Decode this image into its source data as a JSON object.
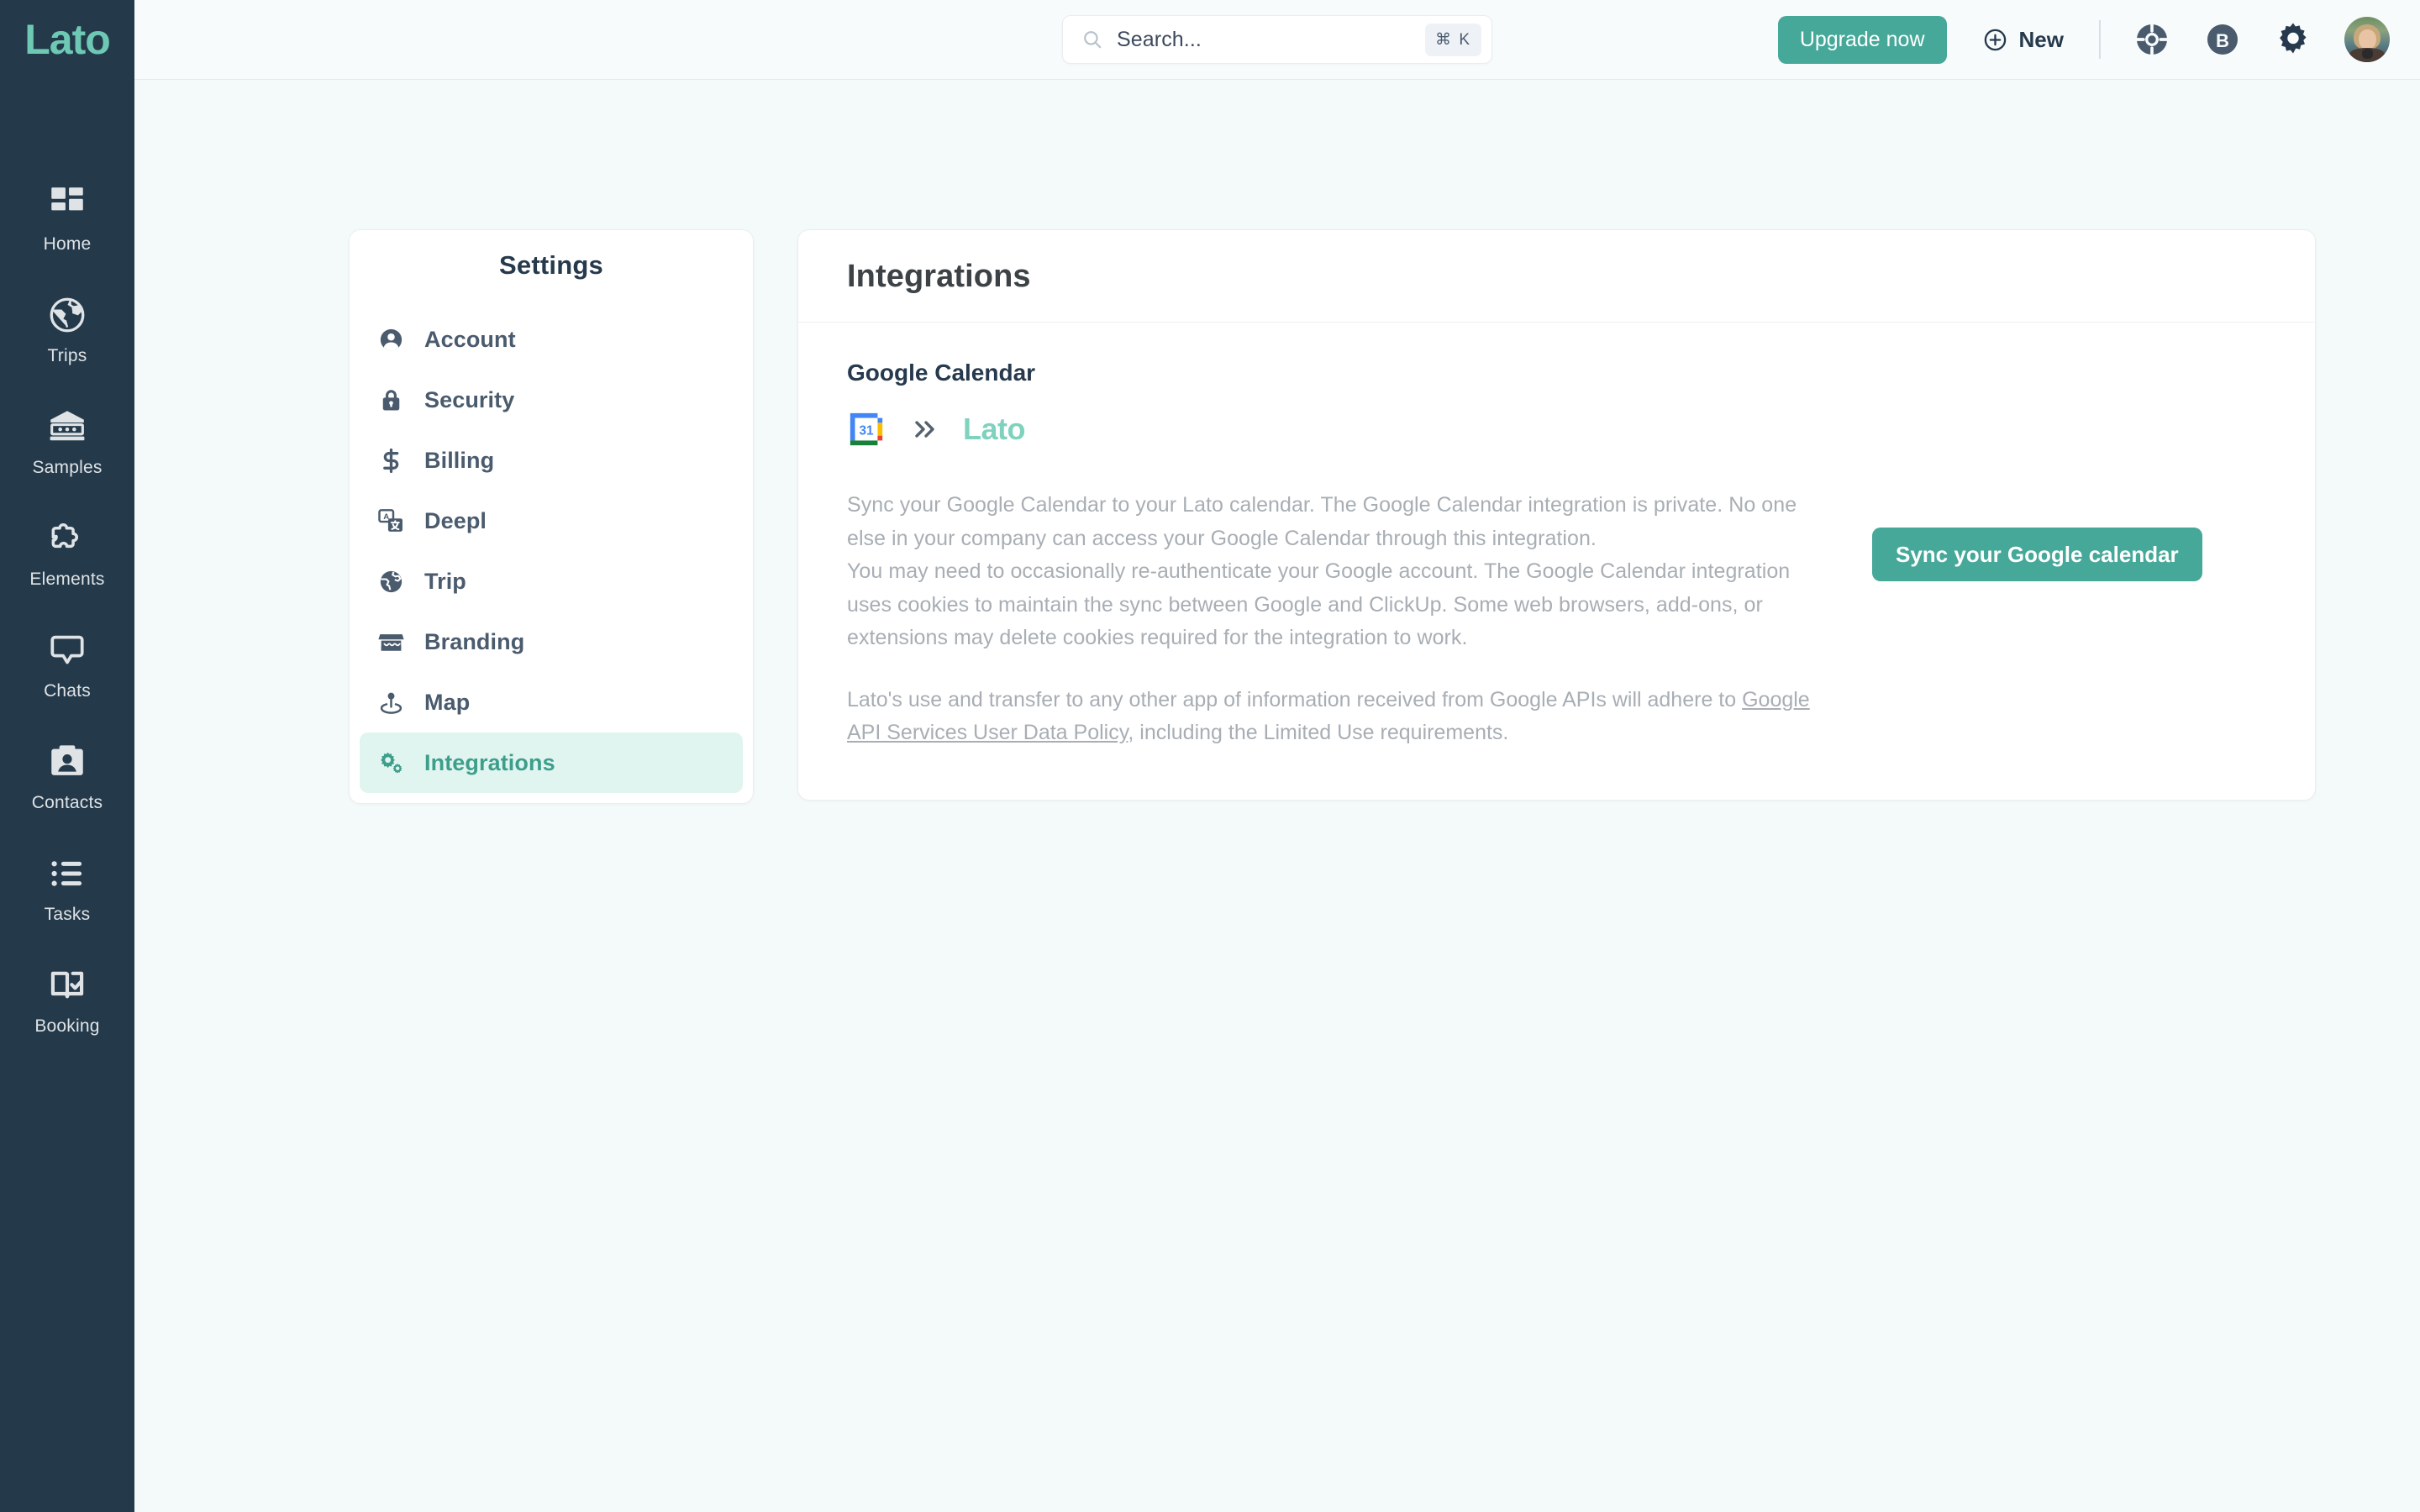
{
  "brand": {
    "name": "Lato"
  },
  "rail": {
    "items": [
      {
        "icon": "dashboard-icon",
        "label": "Home"
      },
      {
        "icon": "globe-icon",
        "label": "Trips"
      },
      {
        "icon": "bank-icon",
        "label": "Samples"
      },
      {
        "icon": "puzzle-icon",
        "label": "Elements"
      },
      {
        "icon": "chat-icon",
        "label": "Chats"
      },
      {
        "icon": "contact-card-icon",
        "label": "Contacts"
      },
      {
        "icon": "list-icon",
        "label": "Tasks"
      },
      {
        "icon": "book-check-icon",
        "label": "Booking"
      }
    ]
  },
  "topbar": {
    "search": {
      "placeholder": "Search...",
      "value": "",
      "shortcut": "⌘ K",
      "icon": "search-icon"
    },
    "upgrade_label": "Upgrade now",
    "new_label": "New",
    "new_icon": "plus-circle-icon",
    "icons": [
      {
        "name": "lifebuoy-icon"
      },
      {
        "name": "brand-b-icon"
      },
      {
        "name": "gear-icon"
      }
    ],
    "avatar_alt": "User avatar"
  },
  "settings_panel": {
    "title": "Settings",
    "items": [
      {
        "icon": "person-circle-icon",
        "label": "Account",
        "active": false
      },
      {
        "icon": "lock-icon",
        "label": "Security",
        "active": false
      },
      {
        "icon": "dollar-icon",
        "label": "Billing",
        "active": false
      },
      {
        "icon": "translate-icon",
        "label": "Deepl",
        "active": false
      },
      {
        "icon": "globe-icon",
        "label": "Trip",
        "active": false
      },
      {
        "icon": "storefront-icon",
        "label": "Branding",
        "active": false
      },
      {
        "icon": "map-pin-icon",
        "label": "Map",
        "active": false
      },
      {
        "icon": "gears-icon",
        "label": "Integrations",
        "active": true
      }
    ]
  },
  "main": {
    "title": "Integrations",
    "section_title": "Google Calendar",
    "brand_row": {
      "source_icon": "google-calendar-icon",
      "arrow_icon": "double-chevron-right-icon",
      "target_label": "Lato"
    },
    "paragraph_1": "Sync your Google Calendar to your Lato calendar. The Google Calendar integration is private. No one else in your company can access your Google Calendar through this integration.",
    "paragraph_2": "You may need to occasionally re-authenticate your Google account. The Google Calendar integration uses cookies to maintain the sync between Google and ClickUp. Some web browsers, add-ons, or extensions may delete cookies required for the integration to work.",
    "legal_prefix": "Lato's use and transfer to any other app of information received from Google APIs will adhere to ",
    "legal_link": "Google API Services User Data Policy",
    "legal_suffix": ", including the Limited Use requirements.",
    "sync_button_label": "Sync your Google calendar"
  },
  "colors": {
    "rail_bg": "#243a4b",
    "brand_teal": "#6ec9b4",
    "accent": "#45a899",
    "active_pill_bg": "#e0f5ef",
    "active_pill_text": "#3e9e8c",
    "page_bg": "#f4faf9",
    "card_bg": "#ffffff",
    "muted_text": "#a8aeb4",
    "heading_text": "#26394d"
  }
}
